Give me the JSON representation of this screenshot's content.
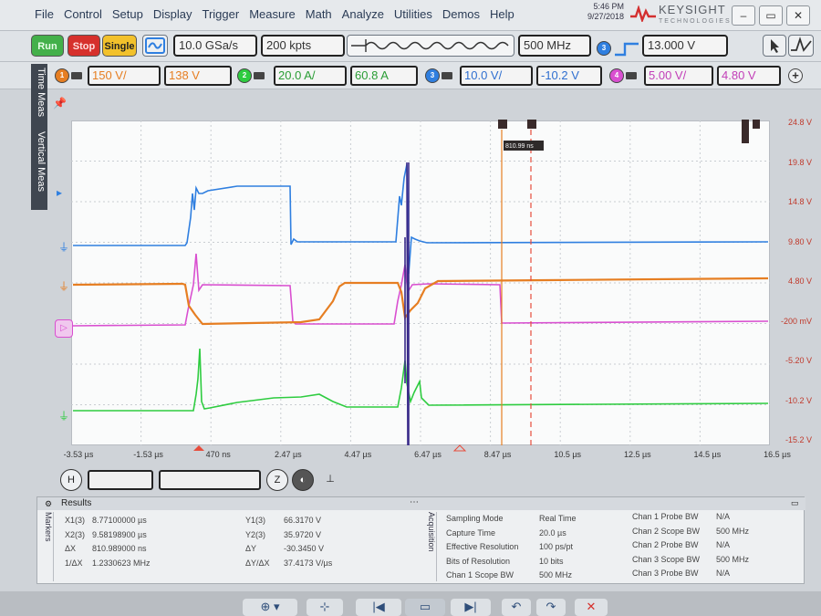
{
  "menu": {
    "items": [
      "File",
      "Control",
      "Setup",
      "Display",
      "Trigger",
      "Measure",
      "Math",
      "Analyze",
      "Utilities",
      "Demos",
      "Help"
    ]
  },
  "clock": {
    "time": "5:46 PM",
    "date": "9/27/2018"
  },
  "brand": {
    "name": "KEYSIGHT",
    "sub": "TECHNOLOGIES"
  },
  "toolbar": {
    "run_label": "Run",
    "stop_label": "Stop",
    "single_label": "Single",
    "sample_rate": "10.0 GSa/s",
    "memory_depth": "200 kpts",
    "bandwidth": "500 MHz",
    "trigger_level": "13.000 V"
  },
  "channels": [
    {
      "num": "1",
      "color": "#e67e22",
      "scale": "150 V/",
      "offset": "138 V"
    },
    {
      "num": "2",
      "color": "#2ecc40",
      "scale": "20.0 A/",
      "offset": "60.8 A"
    },
    {
      "num": "3",
      "color": "#2f7fe0",
      "scale": "10.0 V/",
      "offset": "-10.2 V"
    },
    {
      "num": "4",
      "color": "#d94fd0",
      "scale": "5.00 V/",
      "offset": "4.80 V"
    }
  ],
  "sidetabs": [
    "Time Meas",
    "Vertical Meas"
  ],
  "waveform": {
    "time_ticks": [
      "-3.53 µs",
      "-1.53 µs",
      "470 ns",
      "2.47 µs",
      "4.47 µs",
      "6.47 µs",
      "8.47 µs",
      "10.5 µs",
      "12.5 µs",
      "14.5 µs",
      "16.5 µs"
    ],
    "right_scale": [
      "24.8 V",
      "19.8 V",
      "14.8 V",
      "9.80 V",
      "4.80 V",
      "-200 mV",
      "-5.20 V",
      "-10.2 V",
      "-15.2 V"
    ],
    "marker_delta": "810.99 ns"
  },
  "horizontal": {
    "h_label": "H"
  },
  "results": {
    "title": "Results",
    "side_tabs": [
      "Markers",
      "Acquisition"
    ],
    "markers": [
      {
        "label": "X1(3)",
        "value": "8.77100000 µs"
      },
      {
        "label": "X2(3)",
        "value": "9.58198900 µs"
      },
      {
        "label": "ΔX",
        "value": "810.989000 ns"
      },
      {
        "label": "1/ΔX",
        "value": "1.2330623 MHz"
      }
    ],
    "yvals": [
      {
        "label": "Y1(3)",
        "value": "66.3170 V"
      },
      {
        "label": "Y2(3)",
        "value": "35.9720 V"
      },
      {
        "label": "ΔY",
        "value": "-30.3450 V"
      },
      {
        "label": "ΔY/ΔX",
        "value": "37.4173 V/µs"
      }
    ],
    "acquisition": [
      {
        "label": "Sampling Mode",
        "value": "Real Time"
      },
      {
        "label": "Capture Time",
        "value": "20.0 µs"
      },
      {
        "label": "Effective Resolution",
        "value": "100 ps/pt"
      },
      {
        "label": "Bits of Resolution",
        "value": "10 bits"
      },
      {
        "label": "Chan 1 Scope BW",
        "value": "500 MHz"
      }
    ],
    "probe": [
      {
        "label": "Chan 1 Probe BW",
        "value": "N/A"
      },
      {
        "label": "Chan 2 Scope BW",
        "value": "500 MHz"
      },
      {
        "label": "Chan 2 Probe BW",
        "value": "N/A"
      },
      {
        "label": "Chan 3 Scope BW",
        "value": "500 MHz"
      },
      {
        "label": "Chan 3 Probe BW",
        "value": "N/A"
      }
    ]
  }
}
